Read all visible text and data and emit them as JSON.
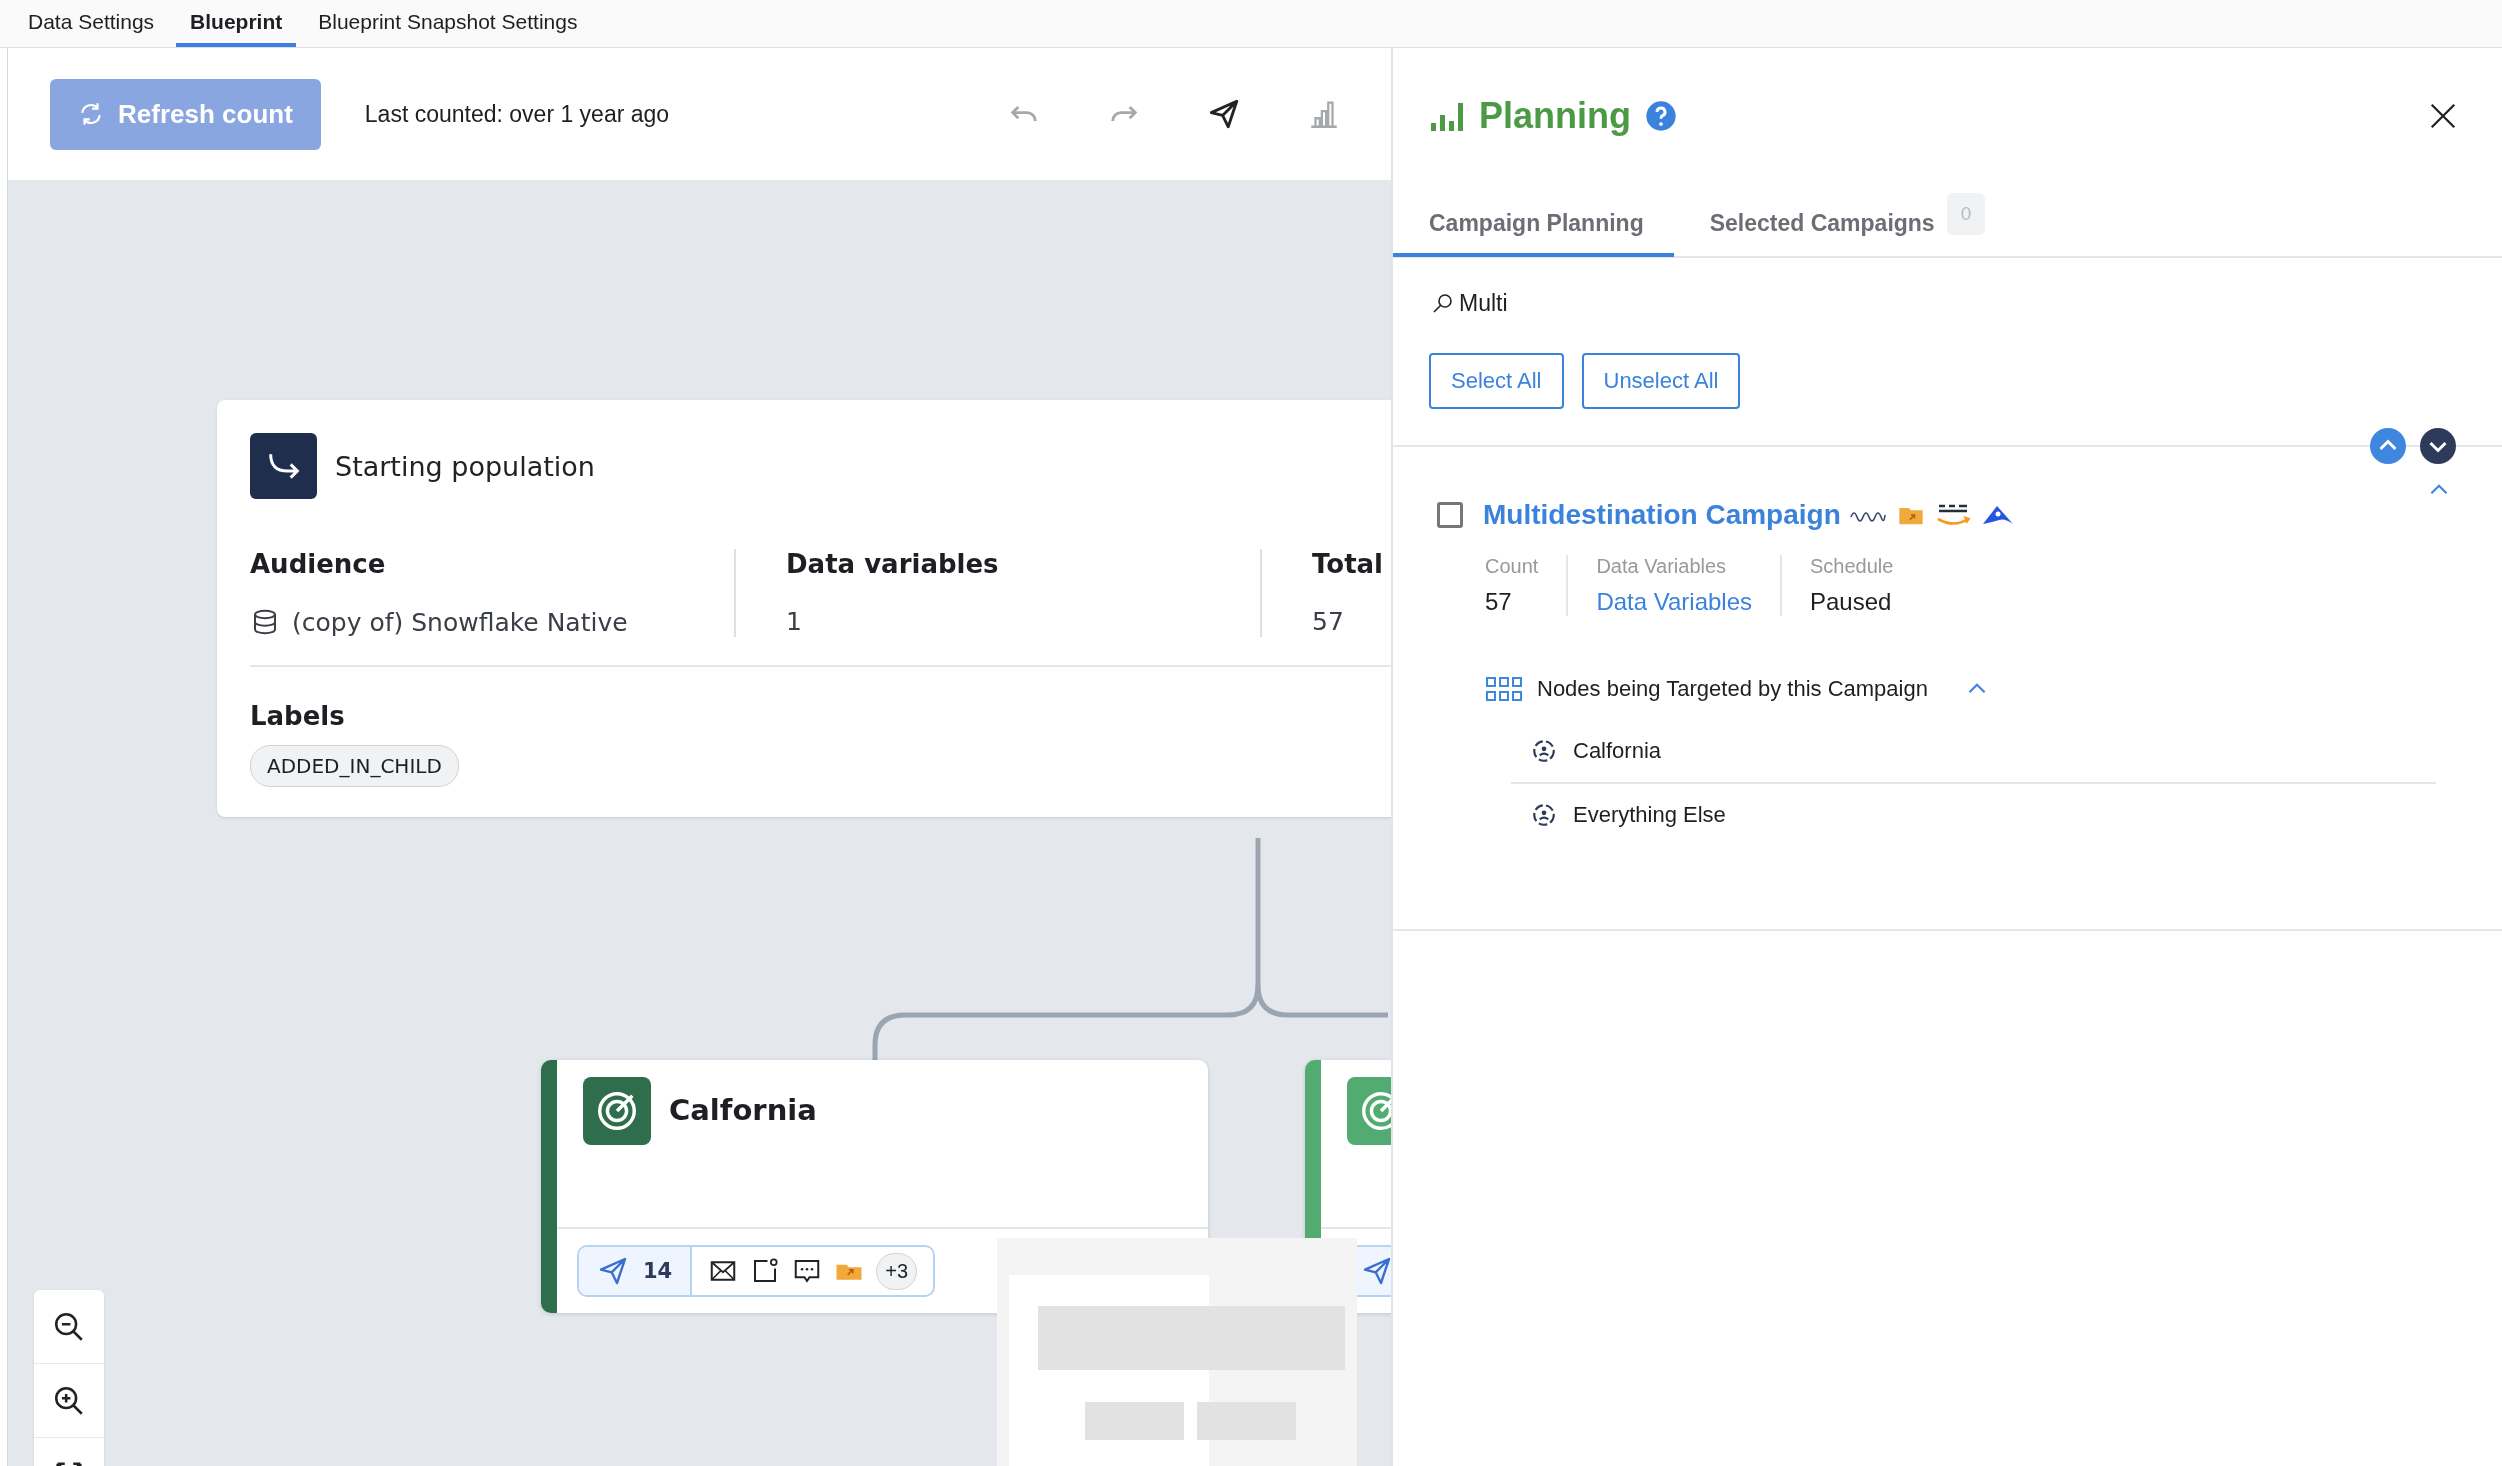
{
  "top_tabs": [
    {
      "label": "Data Settings",
      "selected": false
    },
    {
      "label": "Blueprint",
      "selected": true
    },
    {
      "label": "Blueprint Snapshot Settings",
      "selected": false
    }
  ],
  "toolbar": {
    "refresh_button": {
      "label": "Refresh count",
      "disabled": true
    },
    "last_counted": "Last counted: over 1 year ago",
    "tools": [
      {
        "kind": "undo",
        "disabled": true
      },
      {
        "kind": "redo",
        "disabled": true
      },
      {
        "kind": "send",
        "disabled": false
      },
      {
        "kind": "chart",
        "disabled": true
      }
    ]
  },
  "canvas": {
    "start_node": {
      "title": "Starting population",
      "columns": [
        {
          "heading": "Audience",
          "value": "(copy of) Snowflake Native",
          "kind": "database"
        },
        {
          "heading": "Data variables",
          "value": "1",
          "kind": "plain"
        },
        {
          "heading": "Total",
          "value": "57",
          "kind": "plain"
        }
      ],
      "labels_heading": "Labels",
      "labels": [
        "ADDED_IN_CHILD"
      ]
    },
    "nodes": [
      {
        "title": "Calfornia",
        "color": "#2f6e4c",
        "send_count": "14",
        "more": "+3"
      },
      {
        "color": "#52ac72"
      }
    ]
  },
  "panel": {
    "title": "Planning",
    "tabs": [
      {
        "label": "Campaign Planning",
        "selected": true
      },
      {
        "label": "Selected Campaigns",
        "selected": false,
        "badge": "0"
      }
    ],
    "search": {
      "value": "Multi"
    },
    "buttons": [
      "Select All",
      "Unselect All"
    ],
    "campaigns": [
      {
        "name": "Multidestination Campaign",
        "checked": false,
        "expanded": true,
        "stats": [
          {
            "label": "Count",
            "value": "57",
            "kind": "plain"
          },
          {
            "label": "Data Variables",
            "value": "Data Variables",
            "kind": "link"
          },
          {
            "label": "Schedule",
            "value": "Paused",
            "kind": "plain"
          }
        ],
        "nodes_heading": "Nodes being Targeted by this Campaign",
        "nodes_expanded": true,
        "nodes": [
          "Calfornia",
          "Everything Else"
        ]
      }
    ]
  }
}
